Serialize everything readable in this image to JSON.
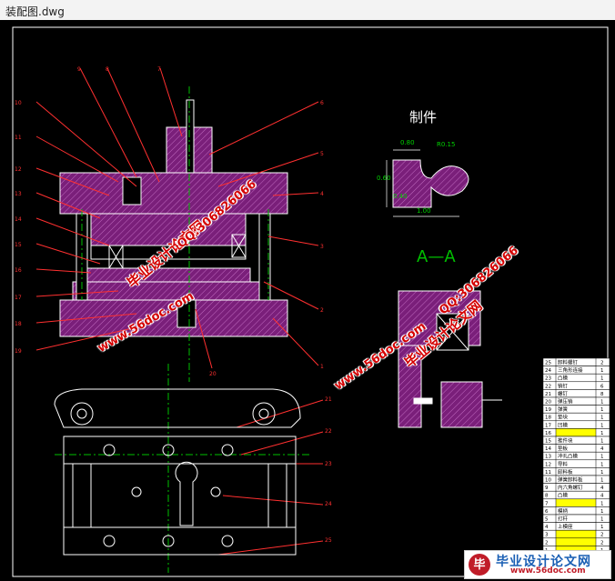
{
  "window": {
    "title": "装配图.dwg"
  },
  "drawing": {
    "part_title": "制件",
    "section_label": "A—A",
    "dims": [
      "0.80",
      "R0.15",
      "0.60",
      "0.40",
      "1.00"
    ],
    "callouts_top": [
      "1",
      "2",
      "3",
      "4",
      "5",
      "6",
      "7",
      "8",
      "9",
      "10",
      "11",
      "12",
      "13",
      "14",
      "15",
      "16",
      "17",
      "18",
      "19",
      "20"
    ],
    "callouts_bottom": [
      "21",
      "22",
      "23",
      "24",
      "25"
    ],
    "bom_rows": [
      {
        "no": "25",
        "name": "卸料螺钉",
        "qty": "2"
      },
      {
        "no": "24",
        "name": "三角形连接",
        "qty": "1"
      },
      {
        "no": "23",
        "name": "凸模",
        "qty": "1"
      },
      {
        "no": "22",
        "name": "销钉",
        "qty": "6"
      },
      {
        "no": "21",
        "name": "螺钉",
        "qty": "8"
      },
      {
        "no": "20",
        "name": "弹压销",
        "qty": "1"
      },
      {
        "no": "19",
        "name": "弹簧",
        "qty": "1"
      },
      {
        "no": "18",
        "name": "垫块",
        "qty": "1"
      },
      {
        "no": "17",
        "name": "凹模",
        "qty": "1"
      },
      {
        "no": "16",
        "name": "",
        "qty": "1"
      },
      {
        "no": "15",
        "name": "推件块",
        "qty": "1"
      },
      {
        "no": "14",
        "name": "垫板",
        "qty": "4"
      },
      {
        "no": "13",
        "name": "冲孔凸模",
        "qty": "1"
      },
      {
        "no": "12",
        "name": "导料",
        "qty": "1"
      },
      {
        "no": "11",
        "name": "卸料板",
        "qty": "1"
      },
      {
        "no": "10",
        "name": "弹簧卸料板",
        "qty": "1"
      },
      {
        "no": "9",
        "name": "内六角螺钉",
        "qty": "4"
      },
      {
        "no": "8",
        "name": "凸模",
        "qty": "4"
      },
      {
        "no": "7",
        "name": "",
        "qty": "1"
      },
      {
        "no": "6",
        "name": "模柄",
        "qty": "1"
      },
      {
        "no": "5",
        "name": "打杆",
        "qty": "1"
      },
      {
        "no": "4",
        "name": "上模座",
        "qty": "1"
      },
      {
        "no": "3",
        "name": "",
        "qty": "2"
      },
      {
        "no": "2",
        "name": "",
        "qty": "2"
      },
      {
        "no": "1",
        "name": "",
        "qty": "1"
      }
    ]
  },
  "watermarks": [
    {
      "text": "毕业设计论文网"
    },
    {
      "text": "QQ:306826066"
    },
    {
      "text": "www.56doc.com"
    },
    {
      "text": "毕业设计论文网"
    },
    {
      "text": "QQ:306826066"
    },
    {
      "text": "www.56doc.com"
    }
  ],
  "logo": {
    "name": "毕业设计论文网",
    "url": "www.56doc.com"
  },
  "colors": {
    "hatch": "#8a2a8a",
    "lines": "#ffffff",
    "center": "#00c000",
    "callout": "#ff3030",
    "bom_cell": "#ffff00"
  }
}
